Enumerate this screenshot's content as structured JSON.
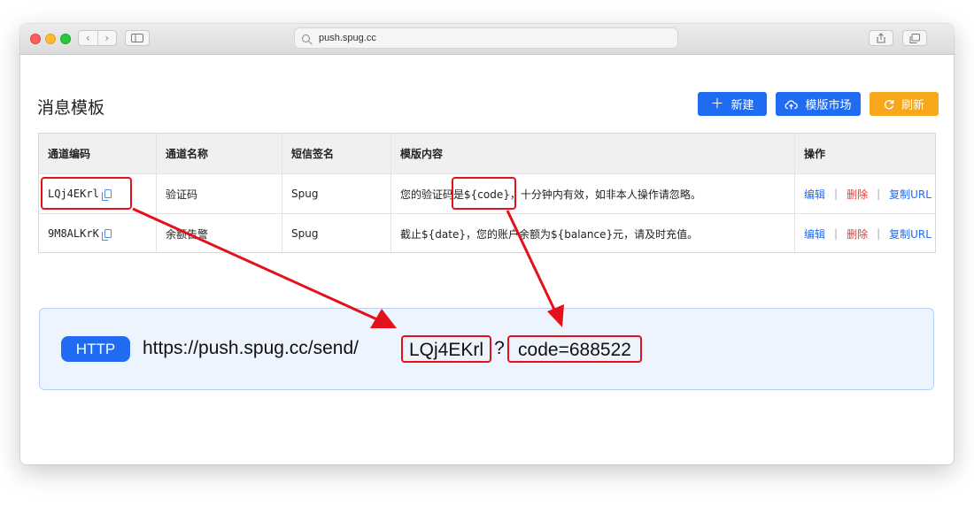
{
  "browser": {
    "url": "push.spug.cc",
    "nav_back": "‹",
    "nav_forward": "›"
  },
  "page": {
    "title": "消息模板",
    "buttons": {
      "new": "新建",
      "market": "模版市场",
      "refresh": "刷新"
    }
  },
  "table": {
    "headers": [
      "通道编码",
      "通道名称",
      "短信签名",
      "模版内容",
      "操作"
    ],
    "rows": [
      {
        "code": "LQj4EKrl",
        "name": "验证码",
        "signature": "Spug",
        "content": "您的验证码是${code}，十分钟内有效，如非本人操作请忽略。",
        "actions": [
          "编辑",
          "删除",
          "复制URL"
        ]
      },
      {
        "code": "9M8ALKrK",
        "name": "余额告警",
        "signature": "Spug",
        "content": "截止${date}，您的账户余额为${balance}元，请及时充值。",
        "actions": [
          "编辑",
          "删除",
          "复制URL"
        ]
      }
    ],
    "separator": "|"
  },
  "http": {
    "badge": "HTTP",
    "base": "https://push.spug.cc/send/",
    "code": "LQj4EKrl",
    "qmark": "?",
    "param": "code=688522"
  },
  "colors": {
    "primary": "#1f6bf2",
    "warning": "#f6a71c",
    "danger": "#e53935",
    "annotation": "#e3111b"
  }
}
